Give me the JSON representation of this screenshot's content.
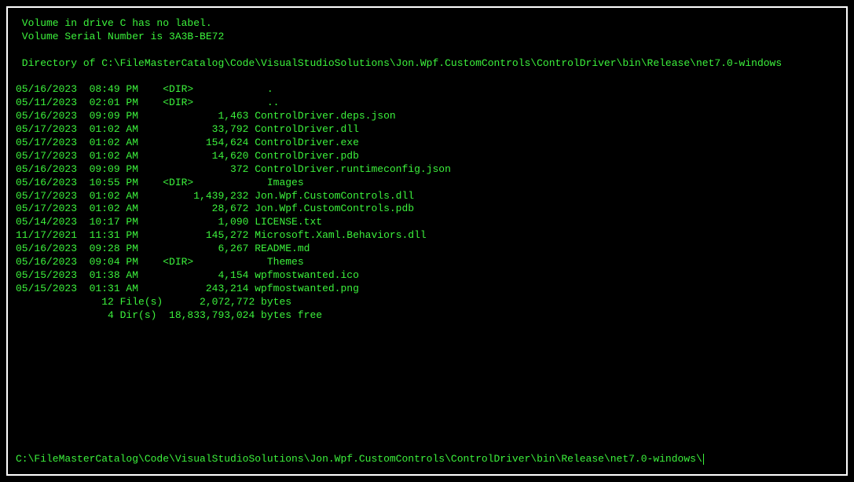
{
  "header": {
    "volume_line": " Volume in drive C has no label.",
    "serial_line": " Volume Serial Number is 3A3B-BE72",
    "directory_line": " Directory of C:\\FileMasterCatalog\\Code\\VisualStudioSolutions\\Jon.Wpf.CustomControls\\ControlDriver\\bin\\Release\\net7.0-windows"
  },
  "entries": [
    {
      "date": "05/16/2023",
      "time": "08:49 PM",
      "dir": "<DIR>",
      "size": "",
      "name": "."
    },
    {
      "date": "05/11/2023",
      "time": "02:01 PM",
      "dir": "<DIR>",
      "size": "",
      "name": ".."
    },
    {
      "date": "05/16/2023",
      "time": "09:09 PM",
      "dir": "",
      "size": "1,463",
      "name": "ControlDriver.deps.json"
    },
    {
      "date": "05/17/2023",
      "time": "01:02 AM",
      "dir": "",
      "size": "33,792",
      "name": "ControlDriver.dll"
    },
    {
      "date": "05/17/2023",
      "time": "01:02 AM",
      "dir": "",
      "size": "154,624",
      "name": "ControlDriver.exe"
    },
    {
      "date": "05/17/2023",
      "time": "01:02 AM",
      "dir": "",
      "size": "14,620",
      "name": "ControlDriver.pdb"
    },
    {
      "date": "05/16/2023",
      "time": "09:09 PM",
      "dir": "",
      "size": "372",
      "name": "ControlDriver.runtimeconfig.json"
    },
    {
      "date": "05/16/2023",
      "time": "10:55 PM",
      "dir": "<DIR>",
      "size": "",
      "name": "Images"
    },
    {
      "date": "05/17/2023",
      "time": "01:02 AM",
      "dir": "",
      "size": "1,439,232",
      "name": "Jon.Wpf.CustomControls.dll"
    },
    {
      "date": "05/17/2023",
      "time": "01:02 AM",
      "dir": "",
      "size": "28,672",
      "name": "Jon.Wpf.CustomControls.pdb"
    },
    {
      "date": "05/14/2023",
      "time": "10:17 PM",
      "dir": "",
      "size": "1,090",
      "name": "LICENSE.txt"
    },
    {
      "date": "11/17/2021",
      "time": "11:31 PM",
      "dir": "",
      "size": "145,272",
      "name": "Microsoft.Xaml.Behaviors.dll"
    },
    {
      "date": "05/16/2023",
      "time": "09:28 PM",
      "dir": "",
      "size": "6,267",
      "name": "README.md"
    },
    {
      "date": "05/16/2023",
      "time": "09:04 PM",
      "dir": "<DIR>",
      "size": "",
      "name": "Themes"
    },
    {
      "date": "05/15/2023",
      "time": "01:38 AM",
      "dir": "",
      "size": "4,154",
      "name": "wpfmostwanted.ico"
    },
    {
      "date": "05/15/2023",
      "time": "01:31 AM",
      "dir": "",
      "size": "243,214",
      "name": "wpfmostwanted.png"
    }
  ],
  "summary": {
    "files_line": "              12 File(s)      2,072,772 bytes",
    "dirs_line": "               4 Dir(s)  18,833,793,024 bytes free"
  },
  "prompt": "C:\\FileMasterCatalog\\Code\\VisualStudioSolutions\\Jon.Wpf.CustomControls\\ControlDriver\\bin\\Release\\net7.0-windows\\"
}
